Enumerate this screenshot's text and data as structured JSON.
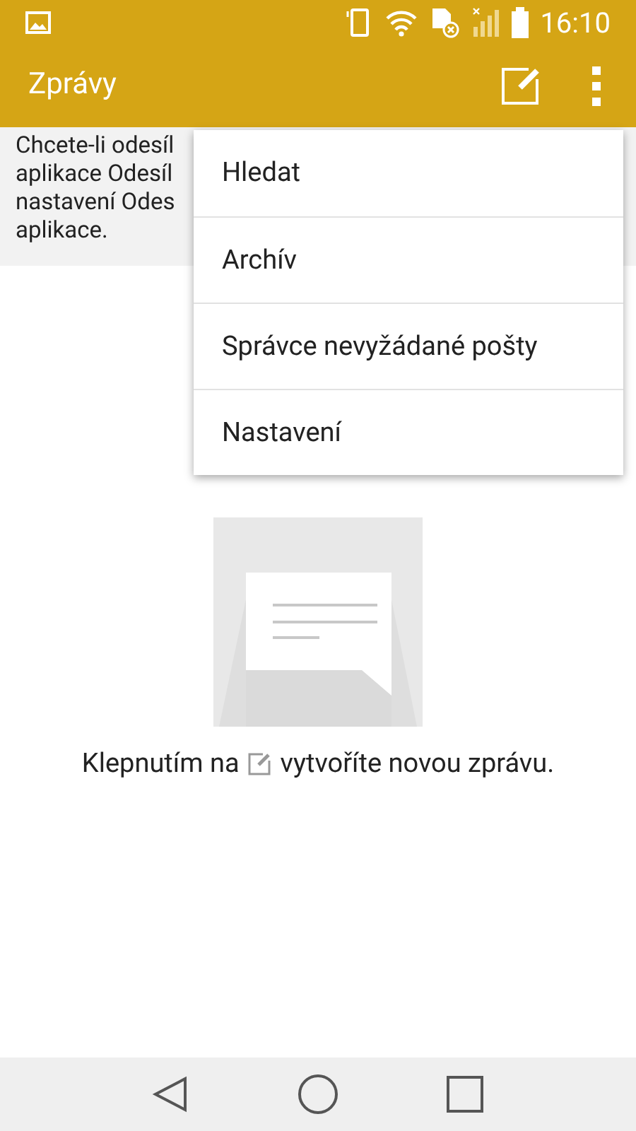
{
  "status_bar": {
    "time": "16:10"
  },
  "app_bar": {
    "title": "Zprávy"
  },
  "banner": {
    "lines": [
      "Chcete-li odesíl",
      "aplikace Odesíl",
      "nastavení Odes",
      "aplikace."
    ]
  },
  "menu": {
    "items": [
      {
        "label": "Hledat"
      },
      {
        "label": "Archív"
      },
      {
        "label": "Správce nevyžádané pošty"
      },
      {
        "label": "Nastavení"
      }
    ]
  },
  "empty_state": {
    "text_before": "Klepnutím na",
    "text_after": "vytvoříte novou zprávu."
  }
}
